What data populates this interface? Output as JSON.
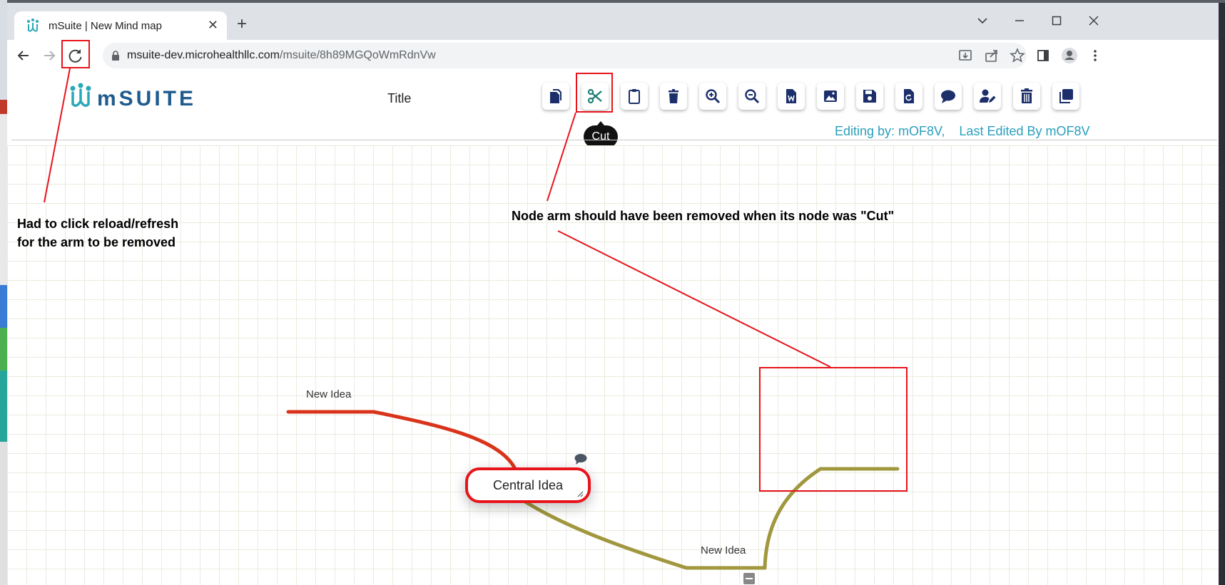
{
  "browser": {
    "tab_title": "mSuite | New Mind map",
    "tab_close": "✕",
    "new_tab": "+",
    "url_host": "msuite-dev.microhealthllc.com",
    "url_path": "/msuite/8h89MGQoWmRdnVw"
  },
  "app": {
    "logo_text": "mSUITE",
    "title": "Title",
    "tooltip": "Cut",
    "editing_by": "Editing by: mOF8V,",
    "last_edited": "Last Edited By mOF8V"
  },
  "toolbar_icons": [
    "copy-icon",
    "cut-icon",
    "paste-icon",
    "delete-icon",
    "zoom-in-icon",
    "zoom-out-icon",
    "word-export-icon",
    "image-export-icon",
    "save-icon",
    "restore-icon",
    "comment-icon",
    "user-edit-icon",
    "trash-icon",
    "duplicate-icon"
  ],
  "mindmap": {
    "central": "Central Idea",
    "left_node": "New Idea",
    "right_node": "New Idea",
    "colors": {
      "left_arm": "#d9341b",
      "right_arm": "#a0973e",
      "accent": "#e8141c"
    }
  },
  "annotations": {
    "reload_note_line1": "Had to click reload/refresh",
    "reload_note_line2": "for the arm to be removed",
    "cut_note": "Node arm should have been removed when its node was \"Cut\""
  },
  "colors": {
    "brand_blue": "#1f5b8e",
    "teal": "#2a9fbc",
    "annotation_red": "#e8141c"
  }
}
